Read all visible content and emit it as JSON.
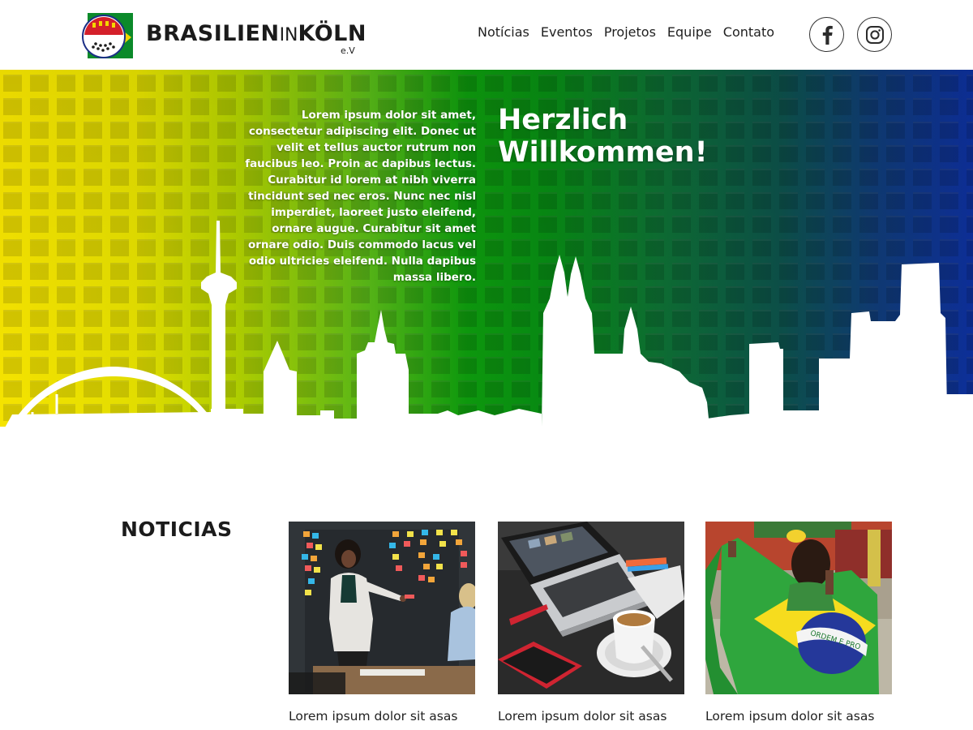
{
  "header": {
    "logo": {
      "text_main": "BRASILIEN",
      "text_in": "IN",
      "text_city": "KÖLN",
      "text_sub": "e.V"
    },
    "nav": [
      {
        "label": "Notícias"
      },
      {
        "label": "Eventos"
      },
      {
        "label": "Projetos"
      },
      {
        "label": "Equipe"
      },
      {
        "label": "Contato"
      }
    ],
    "social": [
      {
        "icon": "facebook-icon"
      },
      {
        "icon": "instagram-icon"
      }
    ]
  },
  "hero": {
    "intro_text": "Lorem ipsum dolor sit amet, consectetur adipiscing elit. Donec ut velit et tellus auctor rutrum non faucibus leo. Proin ac dapibus lectus. Curabitur id lorem at nibh viverra tincidunt sed nec eros. Nunc nec nisl imperdiet, laoreet justo eleifend, ornare augue. Curabitur sit amet ornare odio. Duis commodo lacus vel odio ultricies eleifend. Nulla dapibus massa libero.",
    "title_line1": "Herzlich",
    "title_line2": "Willkommen!",
    "gradient_colors": [
      "#f6e400",
      "#0d990d",
      "#0d2f9a"
    ]
  },
  "news": {
    "heading": "NOTICIAS",
    "cards": [
      {
        "caption": "Lorem ipsum dolor sit asas"
      },
      {
        "caption": "Lorem ipsum dolor sit asas"
      },
      {
        "caption": "Lorem ipsum dolor sit asas"
      }
    ]
  }
}
